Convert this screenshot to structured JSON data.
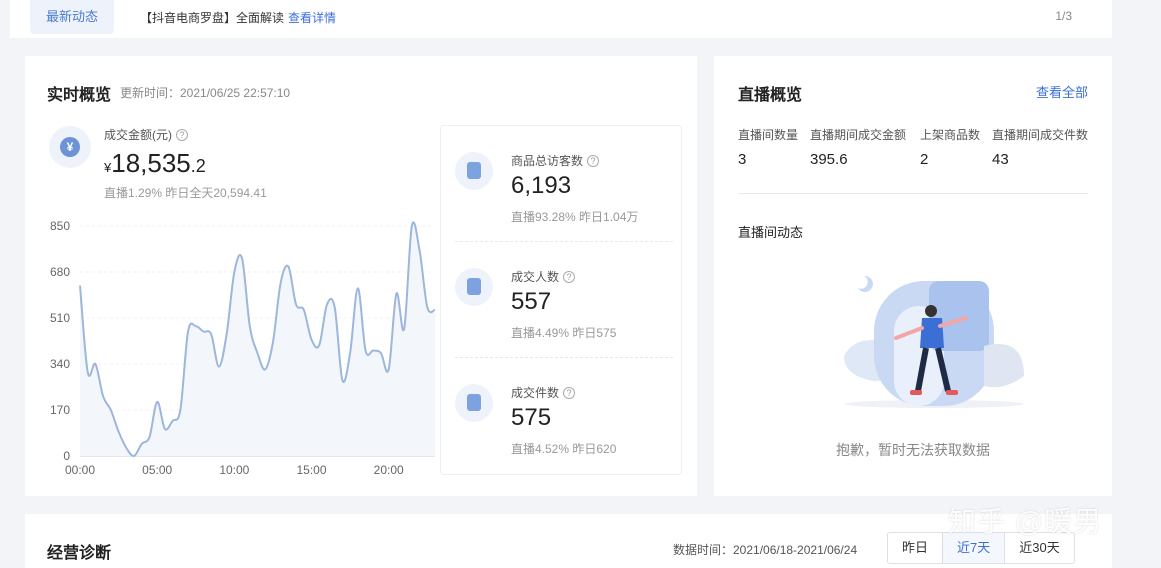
{
  "announcement": {
    "tag": "最新动态",
    "text": "【抖音电商罗盘】全面解读",
    "link": "查看详情",
    "page": "1/3"
  },
  "overview": {
    "title": "实时概览",
    "updated": "更新时间：2021/06/25 22:57:10",
    "gmv": {
      "icon": "yen-icon",
      "label": "成交金额(元)",
      "currency": "¥",
      "value_int": "18,535",
      "value_dec": ".2",
      "sub": "直播1.29%   昨日全天20,594.41"
    },
    "metrics": [
      {
        "icon": "bag-icon",
        "label": "商品总访客数",
        "value": "6,193",
        "sub": "直播93.28%   昨日1.04万"
      },
      {
        "icon": "user-icon",
        "label": "成交人数",
        "value": "557",
        "sub": "直播4.49%   昨日575"
      },
      {
        "icon": "basket-icon",
        "label": "成交件数",
        "value": "575",
        "sub": "直播4.52%   昨日620"
      }
    ]
  },
  "chart_data": {
    "type": "line",
    "title": "",
    "xlabel": "",
    "ylabel": "",
    "x_ticks": [
      "00:00",
      "05:00",
      "10:00",
      "15:00",
      "20:00"
    ],
    "y_ticks": [
      0,
      170,
      340,
      510,
      680,
      850
    ],
    "ylim": [
      0,
      850
    ],
    "xlim": [
      0,
      23
    ],
    "grid": true,
    "series": [
      {
        "color": "#9cb6dc",
        "x": [
          0,
          0.5,
          1,
          1.5,
          2,
          2.5,
          3,
          3.5,
          4,
          4.5,
          5,
          5.5,
          6,
          6.5,
          7,
          7.5,
          8,
          8.5,
          9,
          9.5,
          10,
          10.5,
          11,
          11.5,
          12,
          12.5,
          13,
          13.5,
          14,
          14.5,
          15,
          15.5,
          16,
          16.5,
          17,
          17.5,
          18,
          18.5,
          19,
          19.5,
          20,
          20.5,
          21,
          21.5,
          22,
          22.5,
          23
        ],
        "y": [
          630,
          310,
          340,
          220,
          170,
          90,
          30,
          0,
          45,
          70,
          200,
          100,
          130,
          170,
          460,
          480,
          460,
          450,
          330,
          450,
          680,
          730,
          480,
          380,
          320,
          420,
          640,
          700,
          560,
          540,
          430,
          410,
          560,
          550,
          280,
          380,
          620,
          390,
          390,
          380,
          320,
          600,
          470,
          850,
          760,
          550,
          540
        ]
      }
    ]
  },
  "live": {
    "title": "直播概览",
    "view_all": "查看全部",
    "stats": [
      {
        "label": "直播间数量",
        "value": "3"
      },
      {
        "label": "直播期间成交金额",
        "value": "395.6"
      },
      {
        "label": "上架商品数",
        "value": "2"
      },
      {
        "label": "直播期间成交件数",
        "value": "43"
      }
    ],
    "dynamics_title": "直播间动态",
    "empty_text": "抱歉，暂时无法获取数据"
  },
  "diagnosis": {
    "title": "经营诊断",
    "date_range": "数据时间：2021/06/18-2021/06/24",
    "buttons": [
      "昨日",
      "近7天",
      "近30天"
    ],
    "active": 1
  },
  "watermark": "知乎 @暖男",
  "colors": {
    "accent": "#3b6fd6",
    "line": "#9cb6dc",
    "icon": "#6b93d6"
  }
}
